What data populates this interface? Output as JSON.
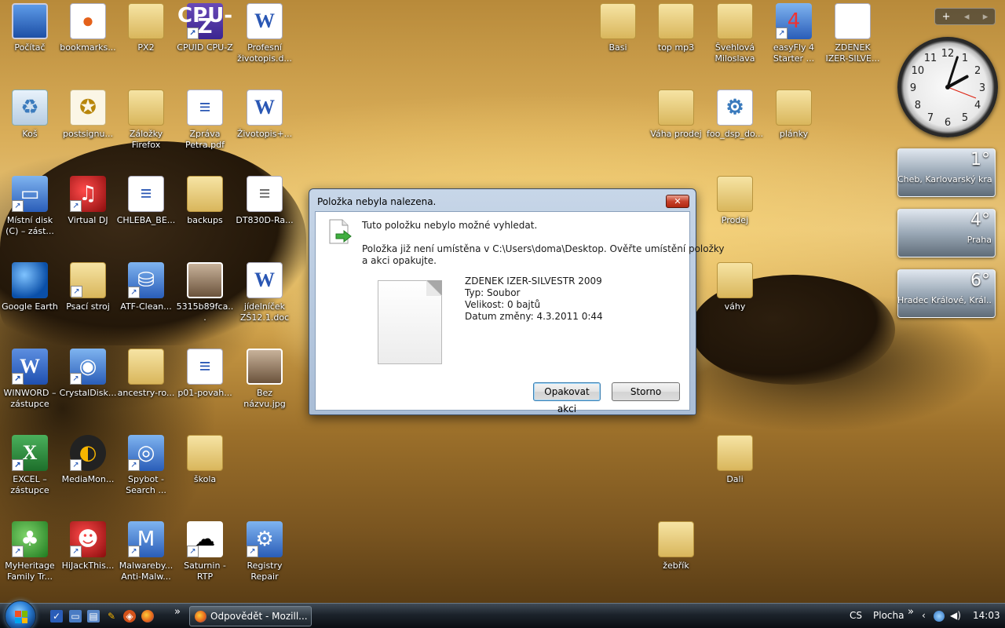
{
  "desktop": {
    "icons": [
      {
        "label": "Počítač",
        "glyph": "monitor-icon"
      },
      {
        "label": "bookmarks...",
        "glyph": "firefox-document-icon"
      },
      {
        "label": "PX2",
        "glyph": "folder-icon"
      },
      {
        "label": "CPUID CPU-Z",
        "glyph": "cpuz-icon"
      },
      {
        "label": "Profesní životopis.d...",
        "glyph": "word-document-icon"
      },
      {
        "label": "Koš",
        "glyph": "recycle-bin-icon"
      },
      {
        "label": "postsignu...",
        "glyph": "certificate-icon"
      },
      {
        "label": "Záložky Firefox",
        "glyph": "folder-icon"
      },
      {
        "label": "Zpráva Petra.pdf",
        "glyph": "pdf-document-icon"
      },
      {
        "label": "Životopis+...",
        "glyph": "word-document-icon"
      },
      {
        "label": "Místní disk (C) – zást...",
        "glyph": "hard-disk-icon"
      },
      {
        "label": "Virtual DJ",
        "glyph": "virtual-dj-icon"
      },
      {
        "label": "CHLEBA_BE...",
        "glyph": "pdf-document-icon"
      },
      {
        "label": "backups",
        "glyph": "folder-icon"
      },
      {
        "label": "DT830D-Ra...",
        "glyph": "document-icon"
      },
      {
        "label": "Google Earth",
        "glyph": "google-earth-icon"
      },
      {
        "label": "Psací stroj",
        "glyph": "folder-icon"
      },
      {
        "label": "ATF-Clean...",
        "glyph": "atf-cleaner-icon"
      },
      {
        "label": "5315b89fca...",
        "glyph": "image-icon"
      },
      {
        "label": "jídelníček ZŠ12.1.doc",
        "glyph": "word-document-icon"
      },
      {
        "label": "WINWORD – zástupce",
        "glyph": "word-app-icon"
      },
      {
        "label": "CrystalDisk...",
        "glyph": "crystaldisk-icon"
      },
      {
        "label": "ancestry-ro...",
        "glyph": "folder-icon"
      },
      {
        "label": "p01-povah...",
        "glyph": "pdf-document-icon"
      },
      {
        "label": "Bez názvu.jpg",
        "glyph": "image-icon"
      },
      {
        "label": "EXCEL – zástupce",
        "glyph": "excel-app-icon"
      },
      {
        "label": "MediaMon...",
        "glyph": "mediamonkey-icon"
      },
      {
        "label": "Spybot - Search ...",
        "glyph": "spybot-icon"
      },
      {
        "label": "škola",
        "glyph": "folder-icon"
      },
      {
        "label": "MyHeritage Family Tr...",
        "glyph": "myheritage-icon"
      },
      {
        "label": "HiJackThis...",
        "glyph": "hijackthis-icon"
      },
      {
        "label": "Malwareby... Anti-Malw...",
        "glyph": "malwarebytes-icon"
      },
      {
        "label": "Saturnin - RTP",
        "glyph": "saturnin-icon"
      },
      {
        "label": "Registry Repair",
        "glyph": "registry-repair-icon"
      },
      {
        "label": "Basi",
        "glyph": "folder-icon"
      },
      {
        "label": "top mp3",
        "glyph": "folder-icon"
      },
      {
        "label": "Švehlová Miloslava",
        "glyph": "folder-icon"
      },
      {
        "label": "easyFly 4 Starter ...",
        "glyph": "easyfly-icon"
      },
      {
        "label": "ZDENEK IZER-SILVE...",
        "glyph": "blank-document-icon"
      },
      {
        "label": "Váha prodej",
        "glyph": "folder-icon"
      },
      {
        "label": "foo_dsp_do...",
        "glyph": "document-icon"
      },
      {
        "label": "plánky",
        "glyph": "folder-icon"
      },
      {
        "label": "Prodej",
        "glyph": "folder-icon"
      },
      {
        "label": "váhy",
        "glyph": "folder-icon"
      },
      {
        "label": "Dali",
        "glyph": "folder-icon"
      },
      {
        "label": "žebřík",
        "glyph": "folder-icon"
      }
    ]
  },
  "gadgets": {
    "clock": {
      "hour": 2,
      "minute": 3,
      "numerals": [
        "12",
        "1",
        "2",
        "3",
        "4",
        "5",
        "6",
        "7",
        "8",
        "9",
        "10",
        "11"
      ]
    },
    "weather": [
      {
        "temp": "1°",
        "city": "Cheb, Karlovarský kraj"
      },
      {
        "temp": "4°",
        "city": "Praha"
      },
      {
        "temp": "6°",
        "city": "Hradec Králové, Král..."
      }
    ]
  },
  "dialog": {
    "title": "Položka nebyla nalezena.",
    "close_label": "✕",
    "heading": "Tuto položku nebylo možné vyhledat.",
    "message_line1": "Položka již není umístěna v C:\\Users\\doma\\Desktop. Ověřte umístění položky",
    "message_line2": "a akci opakujte.",
    "file_name": "ZDENEK IZER-SILVESTR 2009",
    "file_type": "Typ: Soubor",
    "file_size": "Velikost: 0 bajtů",
    "file_date": "Datum změny: 4.3.2011 0:44",
    "retry_label": "Opakovat akci",
    "cancel_label": "Storno"
  },
  "taskbar": {
    "task_label": "Odpovědět - Mozill...",
    "language": "CS",
    "desktop_toolbar": "Plocha",
    "time": "14:03",
    "overflow_chevron": "»"
  }
}
